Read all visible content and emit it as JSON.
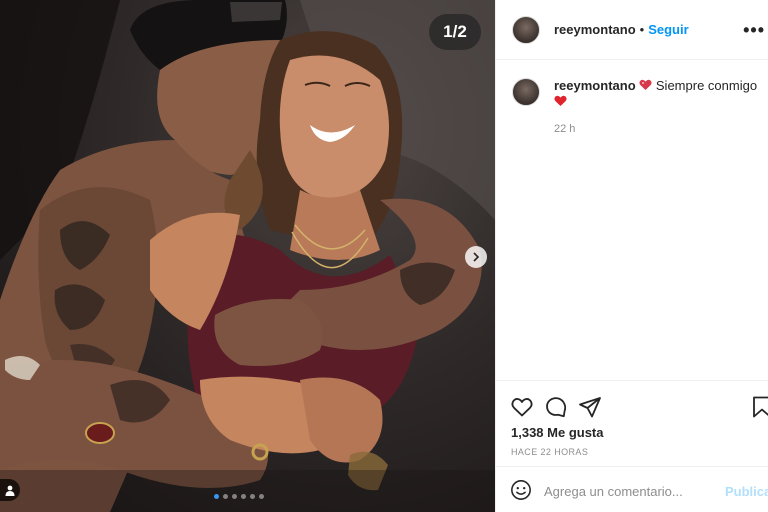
{
  "post": {
    "media_counter": "1/2",
    "carousel": {
      "total": 6,
      "active_index": 0
    }
  },
  "header": {
    "username": "reeymontano",
    "separator": "•",
    "follow_label": "Seguir",
    "more_label": "•••"
  },
  "caption": {
    "username": "reeymontano",
    "text": "Siempre conmigo",
    "emoji_before": "sparkling-heart",
    "emoji_after": "red-heart",
    "time": "22 h"
  },
  "actions": {
    "likes": "1,338 Me gusta",
    "time_ago": "HACE 22 HORAS",
    "icons": [
      "heart-icon",
      "comment-icon",
      "share-icon",
      "bookmark-icon"
    ]
  },
  "comment": {
    "placeholder": "Agrega un comentario...",
    "post_label": "Publicar"
  },
  "colors": {
    "link_blue": "#0095f6",
    "post_disabled": "#b2dffc",
    "heart_red": "#ed4956"
  }
}
